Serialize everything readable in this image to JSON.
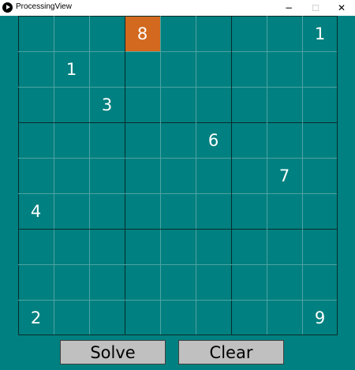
{
  "window": {
    "title": "ProcessingView",
    "minimize_glyph": "−",
    "maximize_glyph": "☐",
    "close_glyph": "✕"
  },
  "board": {
    "size": 9,
    "selected": {
      "row": 0,
      "col": 3
    },
    "selected_color": "#d2691e",
    "background_color": "#008080",
    "cells": [
      [
        "",
        "",
        "",
        "8",
        "",
        "",
        "",
        "",
        "1"
      ],
      [
        "",
        "1",
        "",
        "",
        "",
        "",
        "",
        "",
        ""
      ],
      [
        "",
        "",
        "3",
        "",
        "",
        "",
        "",
        "",
        ""
      ],
      [
        "",
        "",
        "",
        "",
        "",
        "6",
        "",
        "",
        ""
      ],
      [
        "",
        "",
        "",
        "",
        "",
        "",
        "",
        "7",
        ""
      ],
      [
        "4",
        "",
        "",
        "",
        "",
        "",
        "",
        "",
        ""
      ],
      [
        "",
        "",
        "",
        "",
        "",
        "",
        "",
        "",
        ""
      ],
      [
        "",
        "",
        "",
        "",
        "",
        "",
        "",
        "",
        ""
      ],
      [
        "2",
        "",
        "",
        "",
        "",
        "",
        "",
        "",
        "9"
      ]
    ]
  },
  "buttons": {
    "solve_label": "Solve",
    "clear_label": "Clear"
  }
}
